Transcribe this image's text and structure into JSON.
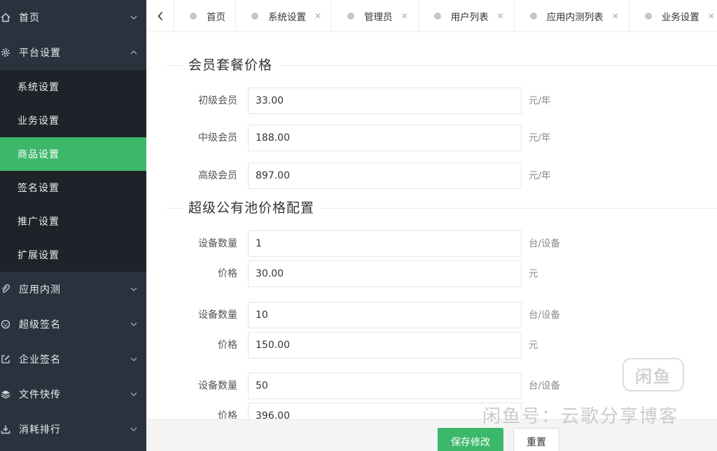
{
  "sidebar": {
    "groups": [
      {
        "label": "首页"
      },
      {
        "label": "平台设置"
      },
      {
        "label": "应用内测"
      },
      {
        "label": "超级签名"
      },
      {
        "label": "企业签名"
      },
      {
        "label": "文件快传"
      },
      {
        "label": "消耗排行"
      }
    ],
    "platform_sub": [
      "系统设置",
      "业务设置",
      "商品设置",
      "签名设置",
      "推广设置",
      "扩展设置"
    ]
  },
  "tabs": [
    {
      "label": "首页"
    },
    {
      "label": "系统设置",
      "close": "✕"
    },
    {
      "label": "管理员",
      "close": "✕"
    },
    {
      "label": "用户列表",
      "close": "✕"
    },
    {
      "label": "应用内测列表",
      "close": "✕"
    },
    {
      "label": "业务设置",
      "close": "✕"
    }
  ],
  "membership": {
    "title": "会员套餐价格",
    "rows": [
      {
        "label": "初级会员",
        "value": "33.00",
        "unit": "元/年"
      },
      {
        "label": "中级会员",
        "value": "188.00",
        "unit": "元/年"
      },
      {
        "label": "高级会员",
        "value": "897.00",
        "unit": "元/年"
      }
    ]
  },
  "pool": {
    "title": "超级公有池价格配置",
    "rows": [
      {
        "label": "设备数量",
        "value": "1",
        "unit": "台/设备"
      },
      {
        "label": "价格",
        "value": "30.00",
        "unit": "元"
      },
      {
        "label": "设备数量",
        "value": "10",
        "unit": "台/设备"
      },
      {
        "label": "价格",
        "value": "150.00",
        "unit": "元"
      },
      {
        "label": "设备数量",
        "value": "50",
        "unit": "台/设备"
      },
      {
        "label": "价格",
        "value": "396.00",
        "unit": ""
      }
    ]
  },
  "footer": {
    "save_label": "保存修改",
    "reset_label": "重置"
  },
  "watermark": {
    "logo": "闲鱼",
    "text": "闲鱼号：云歌分享博客"
  },
  "colors": {
    "sidebar": "#28333e",
    "submenu": "#1f2329",
    "accent": "#3db86a"
  }
}
